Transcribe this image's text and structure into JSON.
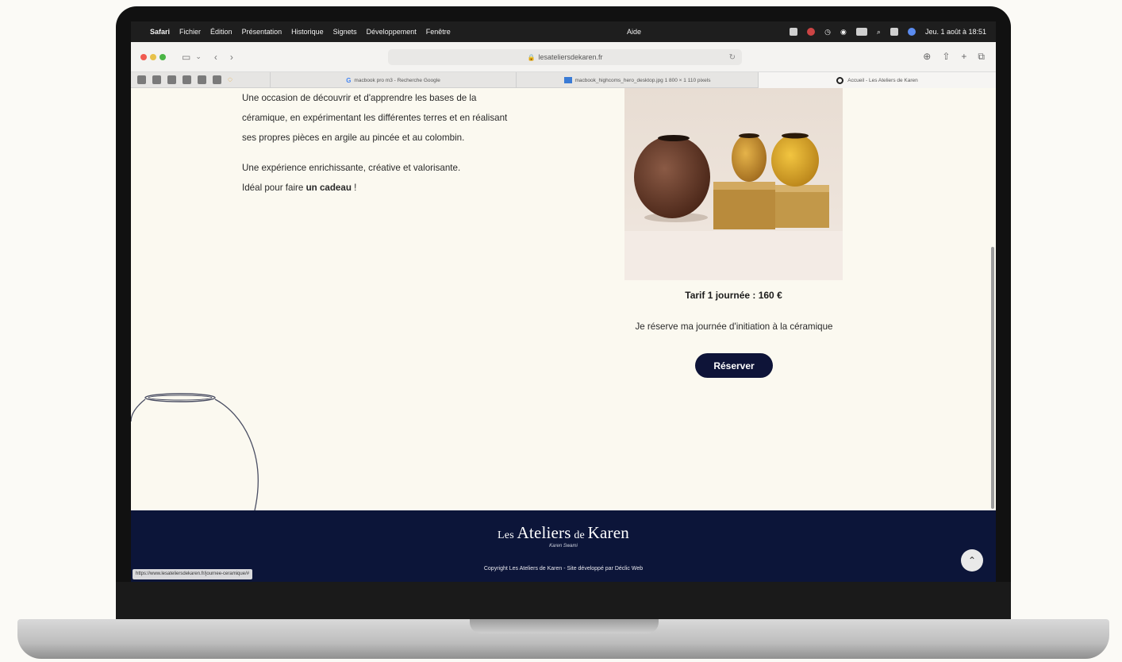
{
  "menubar": {
    "app": "Safari",
    "items": [
      "Fichier",
      "Édition",
      "Présentation",
      "Historique",
      "Signets",
      "Développement",
      "Fenêtre"
    ],
    "help": "Aide",
    "clock": "Jeu. 1 août à 18:51"
  },
  "toolbar": {
    "url": "lesateliersdekaren.fr"
  },
  "tabs": [
    {
      "title": "macbook pro m3 - Recherche Google"
    },
    {
      "title": "macbook_highcoms_hero_desktop.jpg 1 800 × 1 110 pixels"
    },
    {
      "title": "Accueil - Les Ateliers de Karen"
    }
  ],
  "content": {
    "p1_l1": "Une occasion de découvrir et d'apprendre les bases de la",
    "p1_l2": "céramique, en expérimentant les différentes terres et en réalisant",
    "p1_l3": "ses propres pièces en argile au pincée et au colombin.",
    "p2_l1": "Une expérience enrichissante, créative et valorisante.",
    "p2_l2_pre": "Idéal pour faire ",
    "p2_l2_bold": "un cadeau",
    "p2_l2_post": " !",
    "price": "Tarif 1 journée : 160 €",
    "reserve_text": "Je réserve ma journée d'initiation à la céramique",
    "reserve_btn": "Réserver"
  },
  "footer": {
    "logo_les": "Les ",
    "logo_ateliers": "Ateliers",
    "logo_de": " de ",
    "logo_karen": "Karen",
    "subtitle": "Karen Swami",
    "copyright": "Copyright Les Ateliers de Karen - Site développé par Déclic Web",
    "status_url": "https://www.lesateliersdekaren.fr/journee-ceramique/#"
  },
  "colors": {
    "footer_bg": "#0c1539",
    "button_bg": "#0e1438",
    "page_bg": "#fbf9f0"
  }
}
